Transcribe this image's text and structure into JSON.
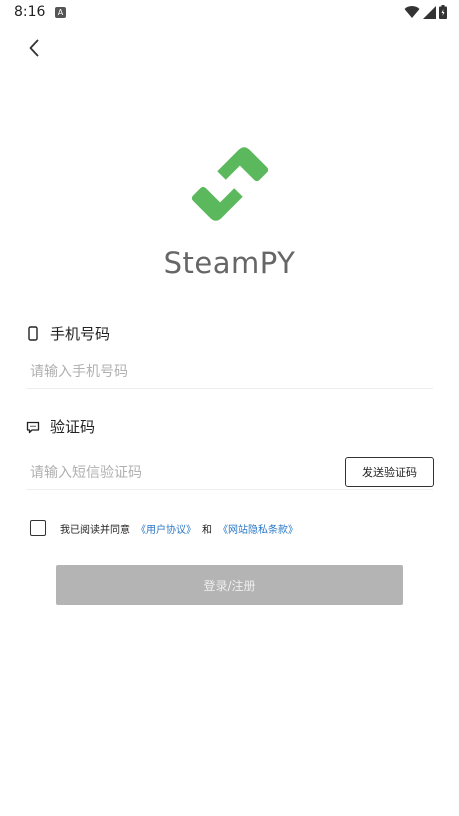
{
  "status_bar": {
    "time": "8:16",
    "notification_letter": "A",
    "icons": [
      "wifi-icon",
      "signal-icon",
      "battery-icon"
    ]
  },
  "header": {
    "back_icon": "chevron-left-icon"
  },
  "brand": {
    "name": "SteamPY",
    "logo_color": "#5cb85c"
  },
  "phone": {
    "icon": "phone-icon",
    "label": "手机号码",
    "placeholder": "请输入手机号码"
  },
  "code": {
    "icon": "message-icon",
    "label": "验证码",
    "placeholder": "请输入短信验证码",
    "send_label": "发送验证码"
  },
  "agreement": {
    "prefix": "我已阅读并同意",
    "user_agreement": "《用户协议》",
    "and": "和",
    "privacy_terms": "《网站隐私条款》",
    "link_color": "#2a78c8"
  },
  "submit_label": "登录/注册"
}
